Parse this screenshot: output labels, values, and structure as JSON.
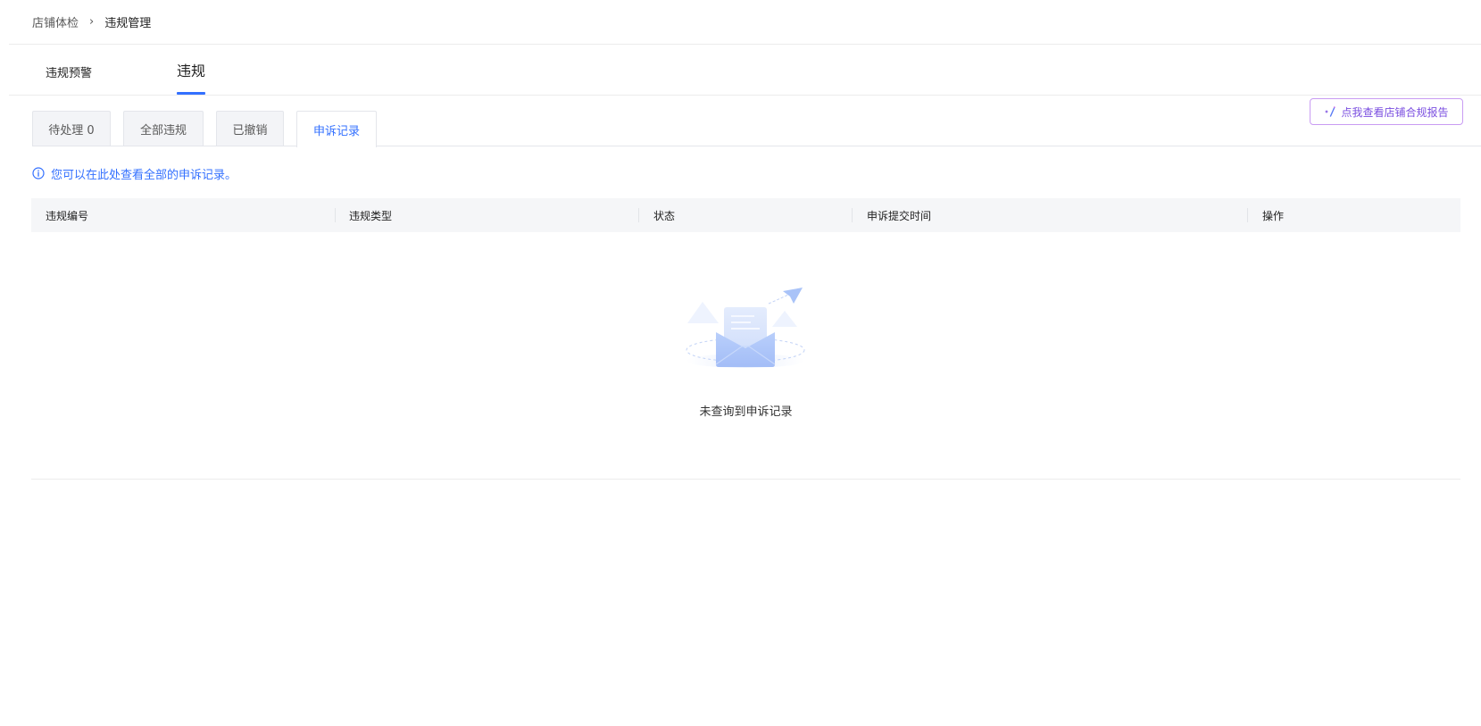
{
  "breadcrumb": {
    "parent": "店铺体检",
    "separator": "›",
    "current": "违规管理"
  },
  "main_tabs": [
    {
      "label": "违规预警",
      "active": false
    },
    {
      "label": "违规",
      "active": true
    }
  ],
  "report_button": {
    "label": "点我查看店铺合规报告",
    "icon": "sparkle-icon"
  },
  "sub_tabs": [
    {
      "label": "待处理 0",
      "active": false
    },
    {
      "label": "全部违规",
      "active": false
    },
    {
      "label": "已撤销",
      "active": false
    },
    {
      "label": "申诉记录",
      "active": true
    }
  ],
  "info_hint": {
    "icon": "info-icon",
    "text": "您可以在此处查看全部的申诉记录。"
  },
  "table": {
    "columns": [
      "违规编号",
      "违规类型",
      "状态",
      "申诉提交时间",
      "操作"
    ],
    "rows": []
  },
  "empty_state": {
    "icon": "empty-envelope-icon",
    "text": "未查询到申诉记录"
  },
  "colors": {
    "accent": "#3370ff",
    "report_border": "#c99cf3",
    "report_text": "#7b4fe0",
    "header_bg": "#f5f6f8"
  }
}
